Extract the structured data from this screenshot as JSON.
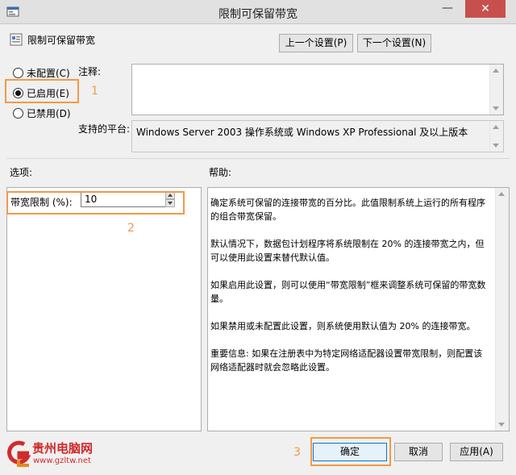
{
  "window": {
    "title": "限制可保留带宽",
    "minimize_glyph": "—",
    "close_glyph": "✕"
  },
  "header": {
    "policy_name": "限制可保留带宽",
    "prev_label": "上一个设置(P)",
    "next_label": "下一个设置(N)"
  },
  "state": {
    "options": [
      {
        "label": "未配置(C)",
        "checked": false
      },
      {
        "label": "已启用(E)",
        "checked": true
      },
      {
        "label": "已禁用(D)",
        "checked": false
      }
    ]
  },
  "comment": {
    "label": "注释:",
    "value": ""
  },
  "platform": {
    "label": "支持的平台:",
    "value": "Windows Server 2003 操作系统或 Windows XP Professional 及以上版本"
  },
  "options_section": {
    "label": "选项:",
    "bandwidth_label": "带宽限制 (%):",
    "bandwidth_value": "10"
  },
  "help_section": {
    "label": "帮助:",
    "paragraphs": [
      "确定系统可保留的连接带宽的百分比。此值限制系统上运行的所有程序的组合带宽保留。",
      "默认情况下，数据包计划程序将系统限制在 20% 的连接带宽之内，但可以使用此设置来替代默认值。",
      "如果启用此设置，则可以使用“带宽限制”框来调整系统可保留的带宽数量。",
      "如果禁用或未配置此设置，则系统使用默认值为 20% 的连接带宽。",
      "重要信息: 如果在注册表中为特定网络适配器设置带宽限制，则配置该网络适配器时就会忽略此设置。"
    ]
  },
  "footer": {
    "ok_label": "确定",
    "cancel_label": "取消",
    "apply_label": "应用(A)"
  },
  "annotations": {
    "n1": "1",
    "n2": "2",
    "n3": "3"
  },
  "watermark": {
    "title": "贵州电脑网",
    "url": "www.gzltw.net"
  },
  "colors": {
    "annotation": "#f39a45",
    "close_button": "#c7504d",
    "watermark": "#d12b2b"
  }
}
